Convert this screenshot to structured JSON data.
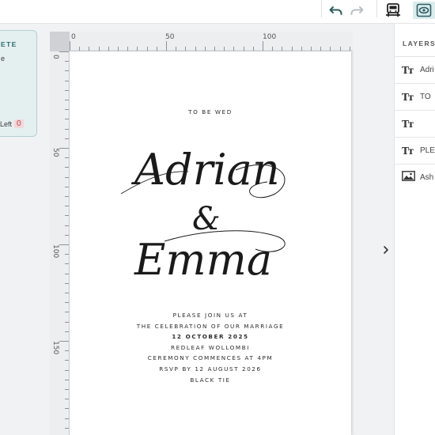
{
  "toolbar": {
    "undo_icon": "undo-icon",
    "redo_icon": "redo-icon",
    "views": [
      {
        "name": "print-preview-icon",
        "active": false
      },
      {
        "name": "eye-icon",
        "active": true
      }
    ]
  },
  "left_panel": {
    "title_fragment": "ETE",
    "sub_fragment": "e",
    "left_label": "Left",
    "left_count": "0",
    "count_color": "#c0404a"
  },
  "rulers": {
    "top_labels": [
      "0",
      "50",
      "100"
    ],
    "left_labels": [
      "0",
      "50",
      "100",
      "150"
    ]
  },
  "invitation": {
    "heading": "TO BE WED",
    "name1": "Adrian",
    "ampersand": "&",
    "name2": "Emma",
    "lines": [
      {
        "text": "PLEASE JOIN US AT",
        "bold": false
      },
      {
        "text": "THE CELEBRATION OF OUR MARRIAGE",
        "bold": false
      },
      {
        "text": "12 OCTOBER 2025",
        "bold": true
      },
      {
        "text": "REDLEAF WOLLOMBI",
        "bold": false
      },
      {
        "text": "CEREMONY COMMENCES AT 4PM",
        "bold": false
      },
      {
        "text": "RSVP BY 12 AUGUST 2026",
        "bold": false
      },
      {
        "text": "BLACK TIE",
        "bold": false
      }
    ]
  },
  "layers": {
    "title": "LAYERS",
    "items": [
      {
        "type": "text",
        "icon": "text-layer-icon",
        "label": "Adri"
      },
      {
        "type": "text",
        "icon": "text-layer-icon",
        "label": "TO"
      },
      {
        "type": "text",
        "icon": "text-layer-icon",
        "label": ""
      },
      {
        "type": "text",
        "icon": "text-layer-icon",
        "label": "PLE"
      },
      {
        "type": "image",
        "icon": "image-layer-icon",
        "label": "Ash"
      }
    ]
  },
  "colors": {
    "accent": "#2c6a70",
    "active_view_bg": "#dbeced",
    "panel_bg": "#e4eff0"
  }
}
